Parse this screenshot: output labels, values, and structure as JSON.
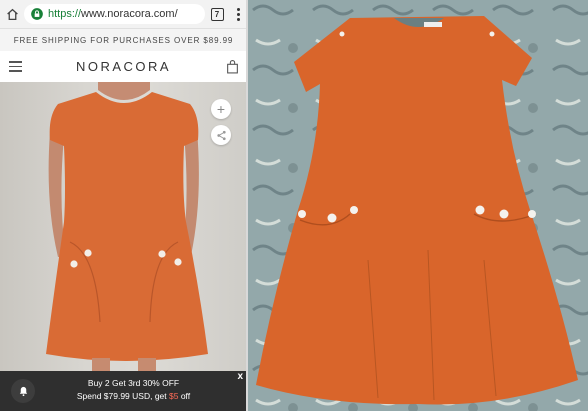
{
  "browser": {
    "url_scheme": "https://",
    "url_host": "www.noracora.com/",
    "tab_count": "7"
  },
  "promo_bar": {
    "text": "FREE SHIPPING FOR PURCHASES OVER $89.99"
  },
  "site_header": {
    "logo": "NORACORA"
  },
  "product_actions": {
    "add_icon": "+"
  },
  "bottom_banner": {
    "line1": "Buy 2 Get 3rd 30% OFF",
    "line2_pre": "Spend $79.99 USD, get ",
    "line2_highlight": "$5",
    "line2_post": " off",
    "close_label": "x"
  },
  "colors": {
    "dress_orange": "#d96b35",
    "banner_bg": "#2f2f2f",
    "highlight_red": "#ff6b57"
  }
}
